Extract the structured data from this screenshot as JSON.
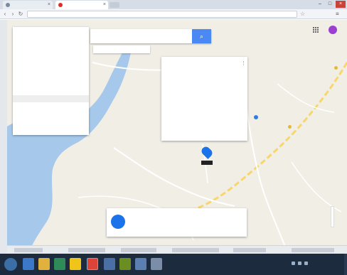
{
  "colors": {
    "map_background": "#f1eee6",
    "water": "#a6c8ea",
    "highway": "#f7d66b",
    "minor_road": "#ffffff",
    "search_button": "#4a89f3",
    "taskbar": "#1d2b3e"
  },
  "browser": {
    "tabs": [
      {
        "label": "",
        "favicon": "document-icon"
      },
      {
        "label": "",
        "favicon": "maps-icon"
      }
    ],
    "url": "",
    "icons": [
      "back-icon",
      "forward-icon",
      "reload-icon",
      "star-icon",
      "menu-icon",
      "close-icon",
      "minimize-icon",
      "maximize-icon"
    ]
  },
  "map": {
    "search": {
      "value": "",
      "placeholder": ""
    },
    "filter_chips": [
      "",
      "",
      ""
    ],
    "side_panel": {
      "title": "",
      "subtitle": "",
      "header": "",
      "items": [
        "",
        "",
        ""
      ],
      "heading2": "",
      "link": ""
    },
    "poi_card": {
      "title": "",
      "rows": [
        {
          "label": "",
          "value": ""
        },
        {
          "label": "",
          "value": ""
        },
        {
          "label": "",
          "value": ""
        },
        {
          "label": "",
          "value": ""
        },
        {
          "label": "",
          "value": ""
        },
        {
          "label": "",
          "value": ""
        }
      ],
      "footer": ""
    },
    "result_card": {
      "title": "",
      "subtitle": ""
    }
  },
  "taskbar": {
    "icons": [
      "start-icon",
      "ie-icon",
      "folder-icon",
      "media-icon",
      "app-icon",
      "chrome-icon",
      "app-icon",
      "app-icon",
      "app-icon",
      "app-icon"
    ],
    "clock": ""
  }
}
